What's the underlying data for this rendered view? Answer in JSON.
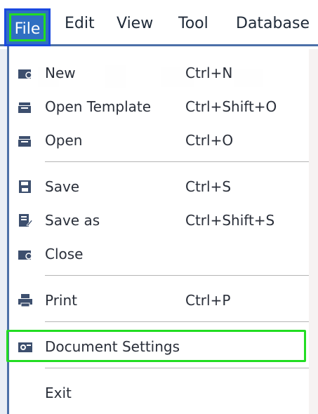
{
  "menubar": {
    "items": [
      "File",
      "Edit",
      "View",
      "Tool",
      "Database"
    ],
    "active": "File"
  },
  "file_menu": {
    "items": [
      {
        "label": "New",
        "shortcut": "Ctrl+N",
        "icon": "new-document-icon"
      },
      {
        "label": "Open Template",
        "shortcut": "Ctrl+Shift+O",
        "icon": "open-template-icon"
      },
      {
        "label": "Open",
        "shortcut": "Ctrl+O",
        "icon": "open-folder-icon"
      },
      {
        "label": "Save",
        "shortcut": "Ctrl+S",
        "icon": "save-disk-icon"
      },
      {
        "label": "Save as",
        "shortcut": "Ctrl+Shift+S",
        "icon": "save-as-icon"
      },
      {
        "label": "Close",
        "shortcut": "",
        "icon": "close-document-icon"
      },
      {
        "label": "Print",
        "shortcut": "Ctrl+P",
        "icon": "printer-icon"
      },
      {
        "label": "Document Settings",
        "shortcut": "",
        "icon": "document-settings-icon",
        "highlighted": true
      },
      {
        "label": "Exit",
        "shortcut": ""
      }
    ]
  },
  "colors": {
    "accent": "#2f6fc2",
    "highlight": "#22dd22",
    "menu_border": "#4c70a8",
    "icon": "#3d4f6e"
  }
}
